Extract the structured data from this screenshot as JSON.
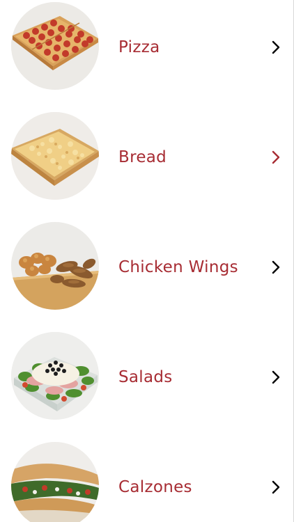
{
  "menu": {
    "categories": [
      {
        "label": "Pizza",
        "image": "pizza-photo",
        "chevron_color": "#000000"
      },
      {
        "label": "Bread",
        "image": "bread-photo",
        "chevron_color": "#a72c33"
      },
      {
        "label": "Chicken Wings",
        "image": "chicken-wings-photo",
        "chevron_color": "#000000"
      },
      {
        "label": "Salads",
        "image": "salad-photo",
        "chevron_color": "#000000"
      },
      {
        "label": "Calzones",
        "image": "calzone-photo",
        "chevron_color": "#000000"
      }
    ]
  },
  "colors": {
    "label": "#a72c33",
    "background": "#ffffff"
  }
}
